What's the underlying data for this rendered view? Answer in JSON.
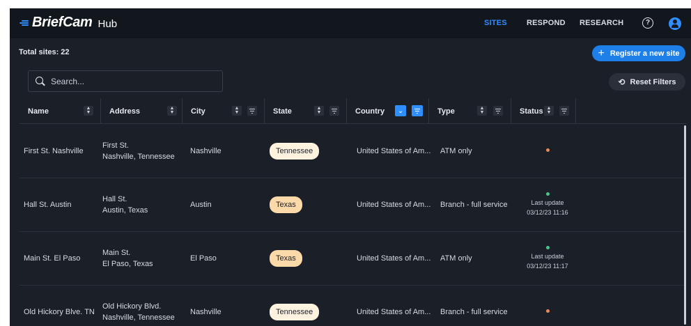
{
  "app": {
    "logo_name": "BriefCam",
    "logo_hub": "Hub"
  },
  "nav": {
    "items": [
      {
        "label": "SITES",
        "active": true
      },
      {
        "label": "RESPOND",
        "active": false
      },
      {
        "label": "RESEARCH",
        "active": false
      }
    ],
    "help_glyph": "?",
    "icons": [
      "help-circle-icon",
      "user-avatar-icon"
    ]
  },
  "toolbar": {
    "total_label": "Total sites: 22",
    "register_label": "Register a new site",
    "reset_label": "Reset Filters",
    "search_placeholder": "Search..."
  },
  "table": {
    "columns": [
      {
        "label": "Name",
        "sort": true,
        "filter": false,
        "sort_active": false,
        "filter_active": false
      },
      {
        "label": "Address",
        "sort": true,
        "filter": false,
        "sort_active": false,
        "filter_active": false
      },
      {
        "label": "City",
        "sort": true,
        "filter": true,
        "sort_active": false,
        "filter_active": false
      },
      {
        "label": "State",
        "sort": true,
        "filter": true,
        "sort_active": false,
        "filter_active": false
      },
      {
        "label": "Country",
        "sort": true,
        "filter": true,
        "sort_active": true,
        "filter_active": true
      },
      {
        "label": "Type",
        "sort": true,
        "filter": true,
        "sort_active": false,
        "filter_active": false
      },
      {
        "label": "Status",
        "sort": true,
        "filter": true,
        "sort_active": false,
        "filter_active": false
      }
    ],
    "rows": [
      {
        "name": "First St. Nashville",
        "address_line1": "First St.",
        "address_line2": "Nashville, Tennessee",
        "city": "Nashville",
        "state": "Tennessee",
        "country": "United States of Am...",
        "type": "ATM only",
        "status_color": "#e8895c",
        "status_line1": "",
        "status_line2": ""
      },
      {
        "name": "Hall St. Austin",
        "address_line1": "Hall St.",
        "address_line2": "Austin, Texas",
        "city": "Austin",
        "state": "Texas",
        "country": "United States of Am...",
        "type": "Branch - full service",
        "status_color": "#4cc38a",
        "status_line1": "Last update",
        "status_line2": "03/12/23 11:16"
      },
      {
        "name": "Main St. El Paso",
        "address_line1": "Main St.",
        "address_line2": "El Paso, Texas",
        "city": "El Paso",
        "state": "Texas",
        "country": "United States of Am...",
        "type": "ATM only",
        "status_color": "#4cc38a",
        "status_line1": "Last update",
        "status_line2": "03/12/23 11:17"
      },
      {
        "name": "Old Hickory Blve. TN",
        "address_line1": "Old Hickory Blvd.",
        "address_line2": "Nashville, Tennessee",
        "city": "Nashville",
        "state": "Tennessee",
        "country": "United States of Am...",
        "type": "Branch - full service",
        "status_color": "#e8895c",
        "status_line1": "",
        "status_line2": ""
      }
    ]
  },
  "colors": {
    "accent": "#2f8fff",
    "background": "#1b1f27",
    "topbar": "#12161d",
    "chip_tennessee": "#fff3e0",
    "chip_texas": "#fcd9a8"
  }
}
